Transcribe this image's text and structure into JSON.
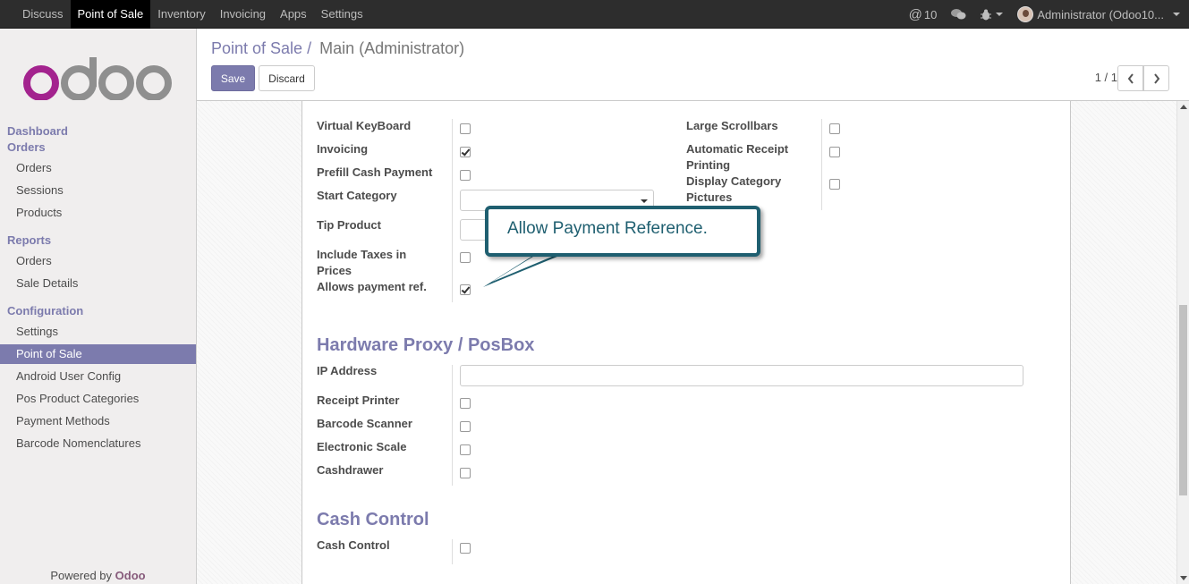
{
  "topbar": {
    "menu": [
      "Discuss",
      "Point of Sale",
      "Inventory",
      "Invoicing",
      "Apps",
      "Settings"
    ],
    "active_menu": "Point of Sale",
    "messages_count": "10",
    "user": "Administrator (Odoo10..."
  },
  "sidebar": {
    "logo_text": "odoo",
    "dashboard": "Dashboard",
    "orders_head": "Orders",
    "orders_items": [
      "Orders",
      "Sessions",
      "Products"
    ],
    "reports_head": "Reports",
    "reports_items": [
      "Orders",
      "Sale Details"
    ],
    "config_head": "Configuration",
    "config_items": [
      "Settings",
      "Point of Sale",
      "Android User Config",
      "Pos Product Categories",
      "Payment Methods",
      "Barcode Nomenclatures"
    ],
    "active_item": "Point of Sale",
    "powered_by": "Powered by",
    "powered_brand": "Odoo"
  },
  "control_panel": {
    "breadcrumb_parent": "Point of Sale",
    "breadcrumb_sep": "/",
    "breadcrumb_current": "Main (Administrator)",
    "save_label": "Save",
    "discard_label": "Discard",
    "pager": "1 / 1"
  },
  "form": {
    "left_fields": {
      "virtual_keyboard": {
        "label": "Virtual KeyBoard",
        "checked": false
      },
      "invoicing": {
        "label": "Invoicing",
        "checked": true
      },
      "prefill_cash": {
        "label": "Prefill Cash Payment",
        "checked": false
      },
      "start_category": {
        "label": "Start Category",
        "value": ""
      },
      "tip_product": {
        "label": "Tip Product",
        "value": ""
      },
      "include_taxes": {
        "label_line1": "Include Taxes in",
        "label_line2": "Prices",
        "checked": false
      },
      "allows_payment_ref": {
        "label": "Allows payment ref.",
        "checked": true
      }
    },
    "right_fields": {
      "large_scrollbars": {
        "label": "Large Scrollbars",
        "checked": false
      },
      "auto_receipt": {
        "label_line1": "Automatic Receipt",
        "label_line2": "Printing",
        "checked": false
      },
      "display_category_pictures": {
        "label_line1": "Display Category",
        "label_line2": "Pictures",
        "checked": false
      }
    },
    "hardware_section": {
      "title": "Hardware Proxy / PosBox",
      "ip_address": {
        "label": "IP Address",
        "value": ""
      },
      "receipt_printer": {
        "label": "Receipt Printer",
        "checked": false
      },
      "barcode_scanner": {
        "label": "Barcode Scanner",
        "checked": false
      },
      "electronic_scale": {
        "label": "Electronic Scale",
        "checked": false
      },
      "cashdrawer": {
        "label": "Cashdrawer",
        "checked": false
      }
    },
    "cash_section": {
      "title": "Cash Control",
      "cash_control": {
        "label": "Cash Control",
        "checked": false
      }
    }
  },
  "callout": {
    "text": "Allow Payment Reference."
  },
  "colors": {
    "brand_purple": "#7c7bad",
    "navbar": "#2d2d2d",
    "callout_border": "#1f5f70",
    "odoo_magenta": "#a3238e"
  }
}
